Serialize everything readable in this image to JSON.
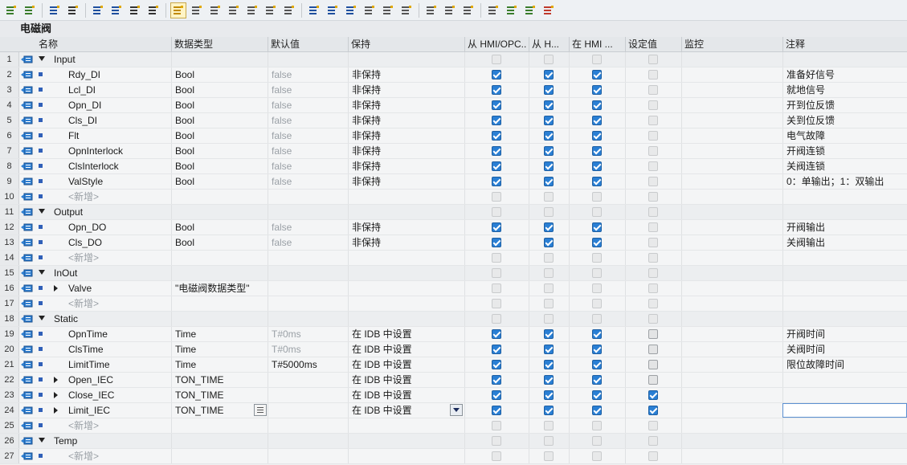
{
  "block_title": "电磁阀",
  "toolbar_icons": [
    "insert-row-icon",
    "add-row-icon",
    "export-icon",
    "download-icon",
    "group-icon",
    "list-icon",
    "snapshot-icon",
    "download-arrow-icon",
    "settings-active-icon",
    "copy-icon",
    "paste-icon",
    "monitor-icon",
    "monitor2-icon",
    "lines-icon",
    "expand-icon",
    "indent-left-icon",
    "indent-right-icon",
    "outdent-icon",
    "align-icon",
    "tree-icon",
    "tree2-icon",
    "breakpoint-icon",
    "back-icon",
    "forward-icon",
    "users-icon",
    "play-icon",
    "play2-icon",
    "database-icon"
  ],
  "columns": {
    "name": "名称",
    "datatype": "数据类型",
    "default": "默认值",
    "retain": "保持",
    "hmi_opc": "从 HMI/OPC...",
    "hmi_h": "从 H...",
    "in_hmi": "在 HMI ...",
    "setpoint": "设定值",
    "monitor": "监控",
    "comment": "注释"
  },
  "rows": [
    {
      "n": "1",
      "kind": "section",
      "name": "Input",
      "type": "",
      "def": "",
      "ret": "",
      "c1": "dis",
      "c2": "dis",
      "c3": "dis",
      "c4": "dis",
      "comment": ""
    },
    {
      "n": "2",
      "kind": "item",
      "name": "Rdy_DI",
      "type": "Bool",
      "def": "false",
      "ret": "非保持",
      "c1": "on",
      "c2": "on",
      "c3": "on",
      "c4": "dis",
      "comment": "准备好信号"
    },
    {
      "n": "3",
      "kind": "item",
      "name": "Lcl_DI",
      "type": "Bool",
      "def": "false",
      "ret": "非保持",
      "c1": "on",
      "c2": "on",
      "c3": "on",
      "c4": "dis",
      "comment": "就地信号"
    },
    {
      "n": "4",
      "kind": "item",
      "name": "Opn_DI",
      "type": "Bool",
      "def": "false",
      "ret": "非保持",
      "c1": "on",
      "c2": "on",
      "c3": "on",
      "c4": "dis",
      "comment": "开到位反馈"
    },
    {
      "n": "5",
      "kind": "item",
      "name": "Cls_DI",
      "type": "Bool",
      "def": "false",
      "ret": "非保持",
      "c1": "on",
      "c2": "on",
      "c3": "on",
      "c4": "dis",
      "comment": "关到位反馈"
    },
    {
      "n": "6",
      "kind": "item",
      "name": "Flt",
      "type": "Bool",
      "def": "false",
      "ret": "非保持",
      "c1": "on",
      "c2": "on",
      "c3": "on",
      "c4": "dis",
      "comment": "电气故障"
    },
    {
      "n": "7",
      "kind": "item",
      "name": "OpnInterlock",
      "type": "Bool",
      "def": "false",
      "ret": "非保持",
      "c1": "on",
      "c2": "on",
      "c3": "on",
      "c4": "dis",
      "comment": "开阀连锁"
    },
    {
      "n": "8",
      "kind": "item",
      "name": "ClsInterlock",
      "type": "Bool",
      "def": "false",
      "ret": "非保持",
      "c1": "on",
      "c2": "on",
      "c3": "on",
      "c4": "dis",
      "comment": "关阀连锁"
    },
    {
      "n": "9",
      "kind": "item",
      "name": "ValStyle",
      "type": "Bool",
      "def": "false",
      "ret": "非保持",
      "c1": "on",
      "c2": "on",
      "c3": "on",
      "c4": "dis",
      "comment": "0：单输出；1：双输出"
    },
    {
      "n": "10",
      "kind": "new",
      "name": "<新增>",
      "type": "",
      "def": "",
      "ret": "",
      "c1": "dis",
      "c2": "dis",
      "c3": "dis",
      "c4": "dis",
      "comment": ""
    },
    {
      "n": "11",
      "kind": "section",
      "name": "Output",
      "type": "",
      "def": "",
      "ret": "",
      "c1": "dis",
      "c2": "dis",
      "c3": "dis",
      "c4": "dis",
      "comment": ""
    },
    {
      "n": "12",
      "kind": "item",
      "name": "Opn_DO",
      "type": "Bool",
      "def": "false",
      "ret": "非保持",
      "c1": "on",
      "c2": "on",
      "c3": "on",
      "c4": "dis",
      "comment": "开阀输出"
    },
    {
      "n": "13",
      "kind": "item",
      "name": "Cls_DO",
      "type": "Bool",
      "def": "false",
      "ret": "非保持",
      "c1": "on",
      "c2": "on",
      "c3": "on",
      "c4": "dis",
      "comment": "关阀输出"
    },
    {
      "n": "14",
      "kind": "new",
      "name": "<新增>",
      "type": "",
      "def": "",
      "ret": "",
      "c1": "dis",
      "c2": "dis",
      "c3": "dis",
      "c4": "dis",
      "comment": ""
    },
    {
      "n": "15",
      "kind": "section",
      "name": "InOut",
      "type": "",
      "def": "",
      "ret": "",
      "c1": "dis",
      "c2": "dis",
      "c3": "dis",
      "c4": "dis",
      "comment": ""
    },
    {
      "n": "16",
      "kind": "struct",
      "name": "Valve",
      "type": "\"电磁阀数据类型\"",
      "def": "",
      "ret": "",
      "c1": "dis",
      "c2": "dis",
      "c3": "dis",
      "c4": "dis",
      "comment": ""
    },
    {
      "n": "17",
      "kind": "new",
      "name": "<新增>",
      "type": "",
      "def": "",
      "ret": "",
      "c1": "dis",
      "c2": "dis",
      "c3": "dis",
      "c4": "dis",
      "comment": ""
    },
    {
      "n": "18",
      "kind": "section",
      "name": "Static",
      "type": "",
      "def": "",
      "ret": "",
      "c1": "dis",
      "c2": "dis",
      "c3": "dis",
      "c4": "dis",
      "comment": ""
    },
    {
      "n": "19",
      "kind": "item",
      "name": "OpnTime",
      "type": "Time",
      "def": "T#0ms",
      "ret": "在 IDB 中设置",
      "c1": "on",
      "c2": "on",
      "c3": "on",
      "c4": "gray",
      "comment": "开阀时间",
      "defmuted": true
    },
    {
      "n": "20",
      "kind": "item",
      "name": "ClsTime",
      "type": "Time",
      "def": "T#0ms",
      "ret": "在 IDB 中设置",
      "c1": "on",
      "c2": "on",
      "c3": "on",
      "c4": "gray",
      "comment": "关阀时间",
      "defmuted": true
    },
    {
      "n": "21",
      "kind": "item",
      "name": "LimitTime",
      "type": "Time",
      "def": "T#5000ms",
      "ret": "在 IDB 中设置",
      "c1": "on",
      "c2": "on",
      "c3": "on",
      "c4": "gray",
      "comment": "限位故障时间",
      "defmuted": false
    },
    {
      "n": "22",
      "kind": "struct",
      "name": "Open_IEC",
      "type": "TON_TIME",
      "def": "",
      "ret": "在 IDB 中设置",
      "c1": "on",
      "c2": "on",
      "c3": "on",
      "c4": "gray",
      "comment": ""
    },
    {
      "n": "23",
      "kind": "struct",
      "name": "Close_IEC",
      "type": "TON_TIME",
      "def": "",
      "ret": "在 IDB 中设置",
      "c1": "on",
      "c2": "on",
      "c3": "on",
      "c4": "on",
      "comment": ""
    },
    {
      "n": "24",
      "kind": "struct",
      "name": "Limit_IEC",
      "type": "TON_TIME",
      "def": "",
      "ret": "在 IDB 中设置",
      "c1": "on",
      "c2": "on",
      "c3": "on",
      "c4": "on",
      "comment": "",
      "editing": true
    },
    {
      "n": "25",
      "kind": "new",
      "name": "<新增>",
      "type": "",
      "def": "",
      "ret": "",
      "c1": "dis",
      "c2": "dis",
      "c3": "dis",
      "c4": "dis",
      "comment": ""
    },
    {
      "n": "26",
      "kind": "section",
      "name": "Temp",
      "type": "",
      "def": "",
      "ret": "",
      "c1": "dis",
      "c2": "dis",
      "c3": "dis",
      "c4": "dis",
      "comment": ""
    },
    {
      "n": "27",
      "kind": "new",
      "name": "<新增>",
      "type": "",
      "def": "",
      "ret": "",
      "c1": "dis",
      "c2": "dis",
      "c3": "dis",
      "c4": "dis",
      "comment": ""
    }
  ]
}
